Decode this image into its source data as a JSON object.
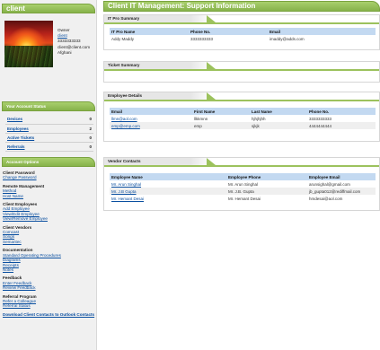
{
  "sidebar": {
    "client_title": "client",
    "profile": {
      "owner_label": "Owner",
      "name_link": "client",
      "phone": "3333333333",
      "email": "client@client.com",
      "city": "Afghani"
    },
    "account_status": {
      "title": "Your Account Status",
      "rows": [
        {
          "label": "Devices",
          "value": "0"
        },
        {
          "label": "Employees",
          "value": "2"
        },
        {
          "label": "Active Tickets",
          "value": "0"
        },
        {
          "label": "Referrals",
          "value": "0"
        }
      ]
    },
    "account_options": {
      "title": "Account Options",
      "groups": [
        {
          "heading": "Client Password",
          "links": [
            "Change Password"
          ]
        },
        {
          "heading": "Remote Management",
          "links": [
            "Method",
            "Host Name"
          ]
        },
        {
          "heading": "Client Employees",
          "links": [
            "Add Employee",
            "View/Edit Employee",
            "View/Remove Employee"
          ]
        },
        {
          "heading": "Client Vendors",
          "links": [
            "Comcast",
            "Songs",
            "Semantec"
          ]
        },
        {
          "heading": "Documentation",
          "links": [
            "Standard Operating Procedures",
            "Diagrams",
            "Receipts",
            "Notes"
          ]
        },
        {
          "heading": "Feedback",
          "links": [
            "Enter Feedback",
            "Review Feedback"
          ]
        },
        {
          "heading": "Referral Program",
          "links": [
            "Refer a Colleague",
            "Referral Status"
          ]
        }
      ],
      "download_link": "Download Client Contacts to Outlook Contacts"
    }
  },
  "main": {
    "title": "Client IT Management: Support Information",
    "it_pro_summary": {
      "title": "IT Pro Summary",
      "columns": [
        "IT Pro Name",
        "Phone No.",
        "Email"
      ],
      "rows": [
        [
          "Addy Maddy",
          "3333333333",
          "imaddy@adds.com"
        ]
      ]
    },
    "ticket_summary": {
      "title": "Ticket Summary"
    },
    "employee_details": {
      "title": "Employee Details",
      "columns": [
        "Email",
        "First Name",
        "Last Name",
        "Phone No."
      ],
      "rows": [
        [
          "llmn@aol.com",
          "llkkmnn",
          "hjhjhjhh",
          "3333333333"
        ],
        [
          "emp@emp.com",
          "emp",
          "sjkjk",
          "4444444444"
        ]
      ]
    },
    "vendor_contacts": {
      "title": "Vendor Contacts",
      "columns": [
        "Employee Name",
        "Employee Phone",
        "Employee Email"
      ],
      "rows": [
        [
          "Mr. Arun Singhal",
          "Mr. Arun Singhal",
          "arunsighal@gmail.com"
        ],
        [
          "Mr. J.B Gupta",
          "Mr. J.B. Gupta",
          "jb_gupta012@rediffmail.com"
        ],
        [
          "Mr. Hemant Desai",
          "Mr. Hemant Desai",
          "hmdesai@aol.com"
        ]
      ]
    }
  },
  "colors": {
    "header_green": "#8fba52",
    "table_header_blue": "#c3d9f1",
    "link_blue": "#0a4fa0"
  }
}
